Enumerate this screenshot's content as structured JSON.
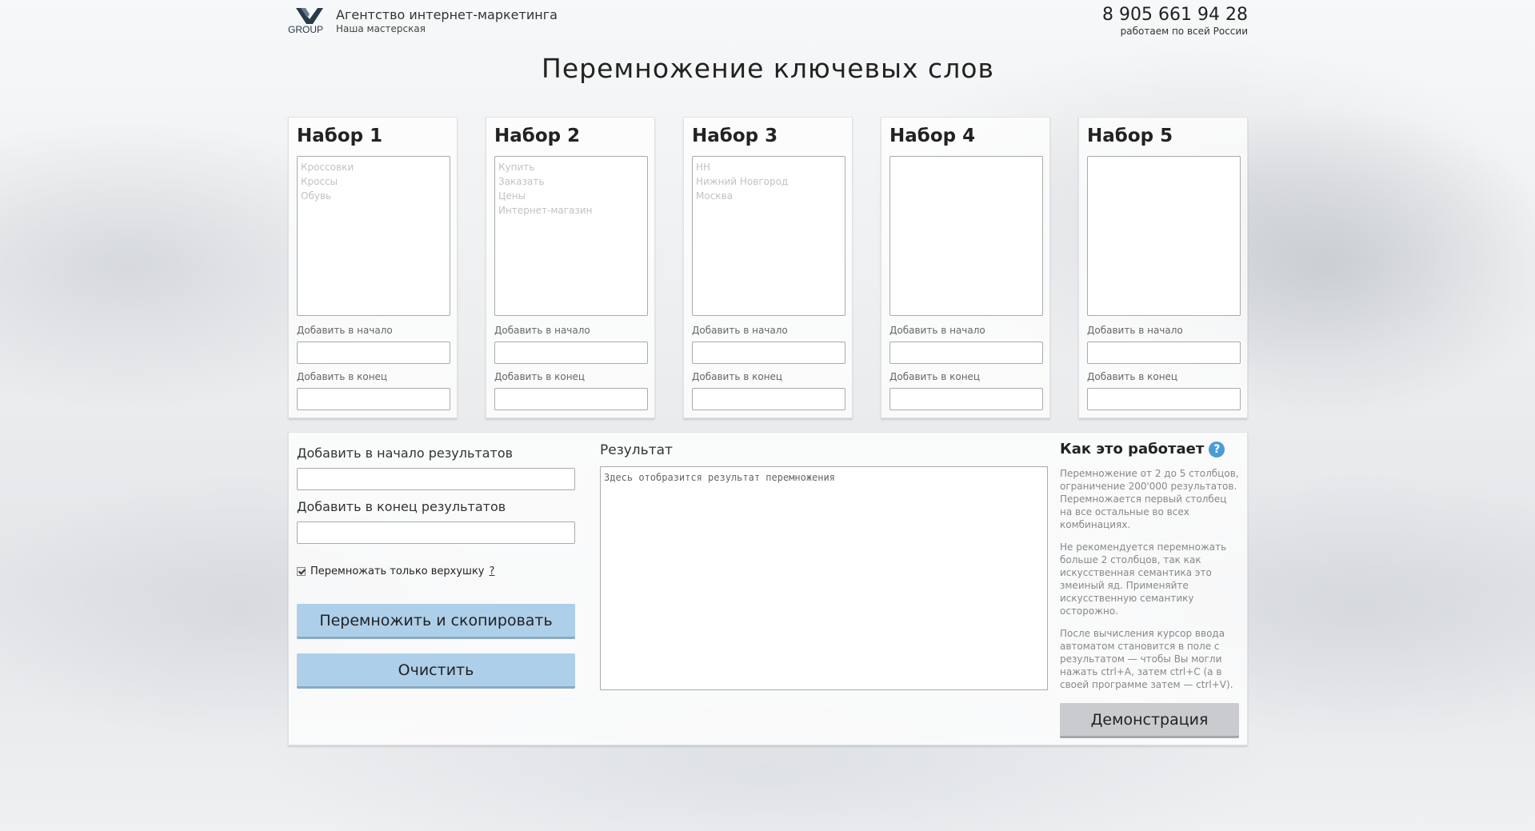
{
  "header": {
    "logo_text": "GROUP",
    "agency_name": "Агентство интернет-маркетинга",
    "agency_sub": "Наша мастерская",
    "phone": "8 905 661 94 28",
    "region": "работаем по всей России"
  },
  "page_title": "Перемножение ключевых слов",
  "sets": [
    {
      "title": "Набор 1",
      "placeholder": "Кроссовки\nКроссы\nОбувь",
      "prefix_label": "Добавить в начало",
      "suffix_label": "Добавить в конец"
    },
    {
      "title": "Набор 2",
      "placeholder": "Купить\nЗаказать\nЦены\nИнтернет-магазин",
      "prefix_label": "Добавить в начало",
      "suffix_label": "Добавить в конец"
    },
    {
      "title": "Набор 3",
      "placeholder": "НН\nНижний Новгород\nМосква",
      "prefix_label": "Добавить в начало",
      "suffix_label": "Добавить в конец"
    },
    {
      "title": "Набор 4",
      "placeholder": "",
      "prefix_label": "Добавить в начало",
      "suffix_label": "Добавить в конец"
    },
    {
      "title": "Набор 5",
      "placeholder": "",
      "prefix_label": "Добавить в начало",
      "suffix_label": "Добавить в конец"
    }
  ],
  "options": {
    "prefix_results_label": "Добавить в начало результатов",
    "suffix_results_label": "Добавить в конец результатов",
    "top_only_label": "Перемножать только верхушку",
    "top_only_checked": true,
    "help_link": "?",
    "multiply_button": "Перемножить и скопировать",
    "clear_button": "Очистить"
  },
  "result": {
    "label": "Результат",
    "placeholder": "Здесь отобразится результат перемножения"
  },
  "how_it_works": {
    "title": "Как это работает",
    "icon": "question-icon",
    "paragraphs": [
      "Перемножение от 2 до 5 столбцов, ограничение 200'000 результатов. Перемножается первый столбец на все остальные во всех комбинациях.",
      "Не рекомендуется перемножать больше 2 столбцов, так как искусственная семантика это змеиный яд. Применяйте искусственную семантику осторожно.",
      "После вычисления курсор ввода автоматом становится в поле с результатом — чтобы Вы могли нажать ctrl+A, затем ctrl+C (а в своей программе затем — ctrl+V)."
    ],
    "demo_button": "Демонстрация"
  },
  "colors": {
    "primary_button": "#aecfe9",
    "secondary_button": "#c9cbce",
    "help_icon": "#4a9cd6"
  }
}
